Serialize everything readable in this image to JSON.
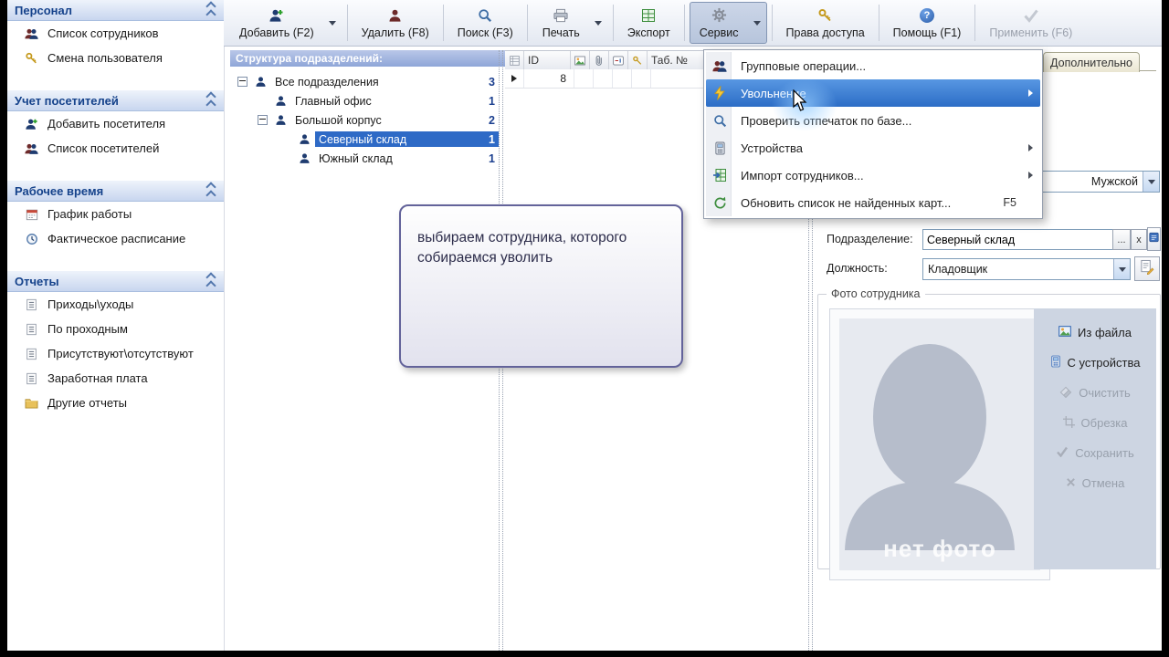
{
  "colors": {
    "selection_blue": "#2e6ac6",
    "menu_highlight_blue": "#2c6dc6",
    "sidebar_header_text": "#15428b",
    "tree_count_blue": "#1b3f8f",
    "callout_border": "#63639a",
    "lightning_yellow": "#f5c93a"
  },
  "sidebar": {
    "sections": [
      {
        "title": "Персонал",
        "items": [
          {
            "label": "Список сотрудников"
          },
          {
            "label": "Смена пользователя"
          }
        ]
      },
      {
        "title": "Учет посетителей",
        "items": [
          {
            "label": "Добавить посетителя"
          },
          {
            "label": "Список посетителей"
          }
        ]
      },
      {
        "title": "Рабочее время",
        "items": [
          {
            "label": "График работы"
          },
          {
            "label": "Фактическое расписание"
          }
        ]
      },
      {
        "title": "Отчеты",
        "items": [
          {
            "label": "Приходы\\уходы"
          },
          {
            "label": "По проходным"
          },
          {
            "label": "Присутствуют\\отсутствуют"
          },
          {
            "label": "Заработная плата"
          },
          {
            "label": "Другие отчеты"
          }
        ]
      }
    ]
  },
  "toolbar": {
    "buttons": [
      {
        "label": "Добавить (F2)"
      },
      {
        "label": "Удалить (F8)"
      },
      {
        "label": "Поиск (F3)"
      },
      {
        "label": "Печать"
      },
      {
        "label": "Экспорт"
      },
      {
        "label": "Сервис"
      },
      {
        "label": "Права доступа"
      },
      {
        "label": "Помощь (F1)"
      },
      {
        "label": "Применить (F6)"
      }
    ]
  },
  "tree": {
    "header": "Структура подразделений:",
    "nodes": [
      {
        "label": "Все подразделения",
        "count": "3"
      },
      {
        "label": "Главный офис",
        "count": "1"
      },
      {
        "label": "Большой корпус",
        "count": "2"
      },
      {
        "label": "Северный склад",
        "count": "1"
      },
      {
        "label": "Южный склад",
        "count": "1"
      }
    ]
  },
  "grid": {
    "columns": {
      "id": "ID",
      "tab": "Таб. №"
    },
    "rows": [
      {
        "id": "8"
      }
    ]
  },
  "service_menu": {
    "items": [
      {
        "label": "Групповые операции..."
      },
      {
        "label": "Увольнение"
      },
      {
        "label": "Проверить отпечаток по базе..."
      },
      {
        "label": "Устройства"
      },
      {
        "label": "Импорт сотрудников..."
      },
      {
        "label": "Обновить список не найденных карт...",
        "shortcut": "F5"
      }
    ]
  },
  "callout": {
    "text": "выбираем сотрудника, которого собираемся уволить"
  },
  "details": {
    "tab": "Дополнительно",
    "gender": {
      "value": "Мужской"
    },
    "department": {
      "label": "Подразделение:",
      "value": "Северный склад",
      "browse_label": "...",
      "clear_label": "x"
    },
    "position": {
      "label": "Должность:",
      "value": "Кладовщик"
    },
    "photo": {
      "group_title": "Фото сотрудника",
      "placeholder": "нет фото",
      "buttons": [
        {
          "label": "Из файла"
        },
        {
          "label": "С устройства"
        },
        {
          "label": "Очистить"
        },
        {
          "label": "Обрезка"
        },
        {
          "label": "Сохранить"
        },
        {
          "label": "Отмена"
        }
      ]
    }
  }
}
